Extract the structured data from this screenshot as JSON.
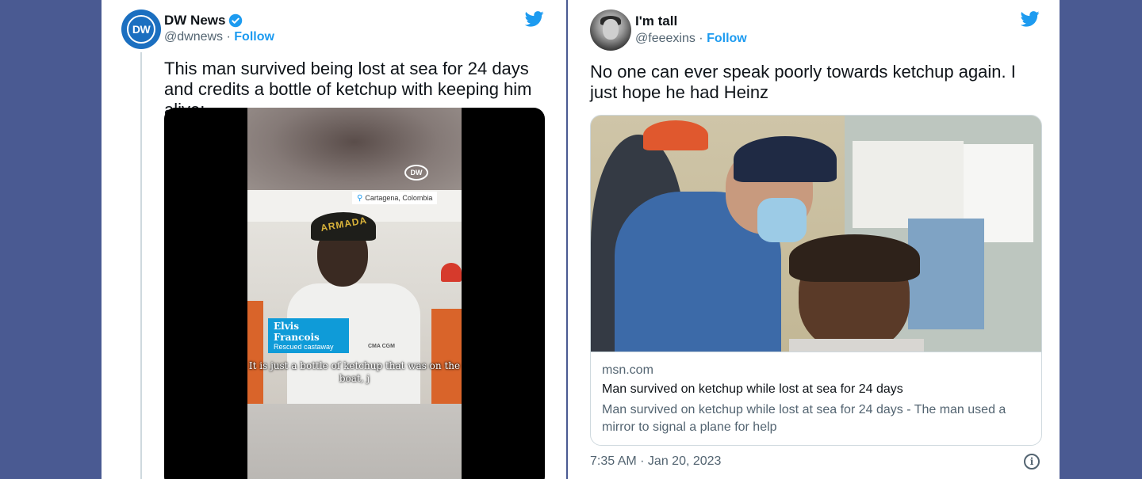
{
  "left_tweet": {
    "author_name": "DW News",
    "avatar_text": "DW",
    "handle": "@dwnews",
    "separator": "·",
    "follow_label": "Follow",
    "text": "This man survived being lost at sea for 24 days and credits a bottle of ketchup with keeping him alive:",
    "video": {
      "watermark": "DW",
      "location": "Cartagena, Colombia",
      "cap_text": "ARMADA",
      "name_tag_name": "Elvis Francois",
      "name_tag_role": "Rescued castaway",
      "shirt_logo": "CMA CGM",
      "subtitle": "It is just a bottle of ketchup that was on the boat, j"
    }
  },
  "right_tweet": {
    "author_name": "I'm tall",
    "handle": "@feeexins",
    "separator": "·",
    "follow_label": "Follow",
    "text": "No one can ever speak poorly towards ketchup again.  I just hope he had Heinz",
    "link_card": {
      "domain": "msn.com",
      "title": "Man survived on ketchup while lost at sea for 24 days",
      "description": "Man survived on ketchup while lost at sea for 24 days - The man used a mirror to signal a plane for help"
    },
    "timestamp": "7:35 AM · Jan 20, 2023"
  },
  "colors": {
    "background": "#4a5a92",
    "twitter_blue": "#1d9bf0",
    "dw_blue": "#1b6fc0"
  },
  "icons": [
    "twitter-bird-icon",
    "verified-badge-icon",
    "location-pin-icon",
    "info-icon"
  ]
}
